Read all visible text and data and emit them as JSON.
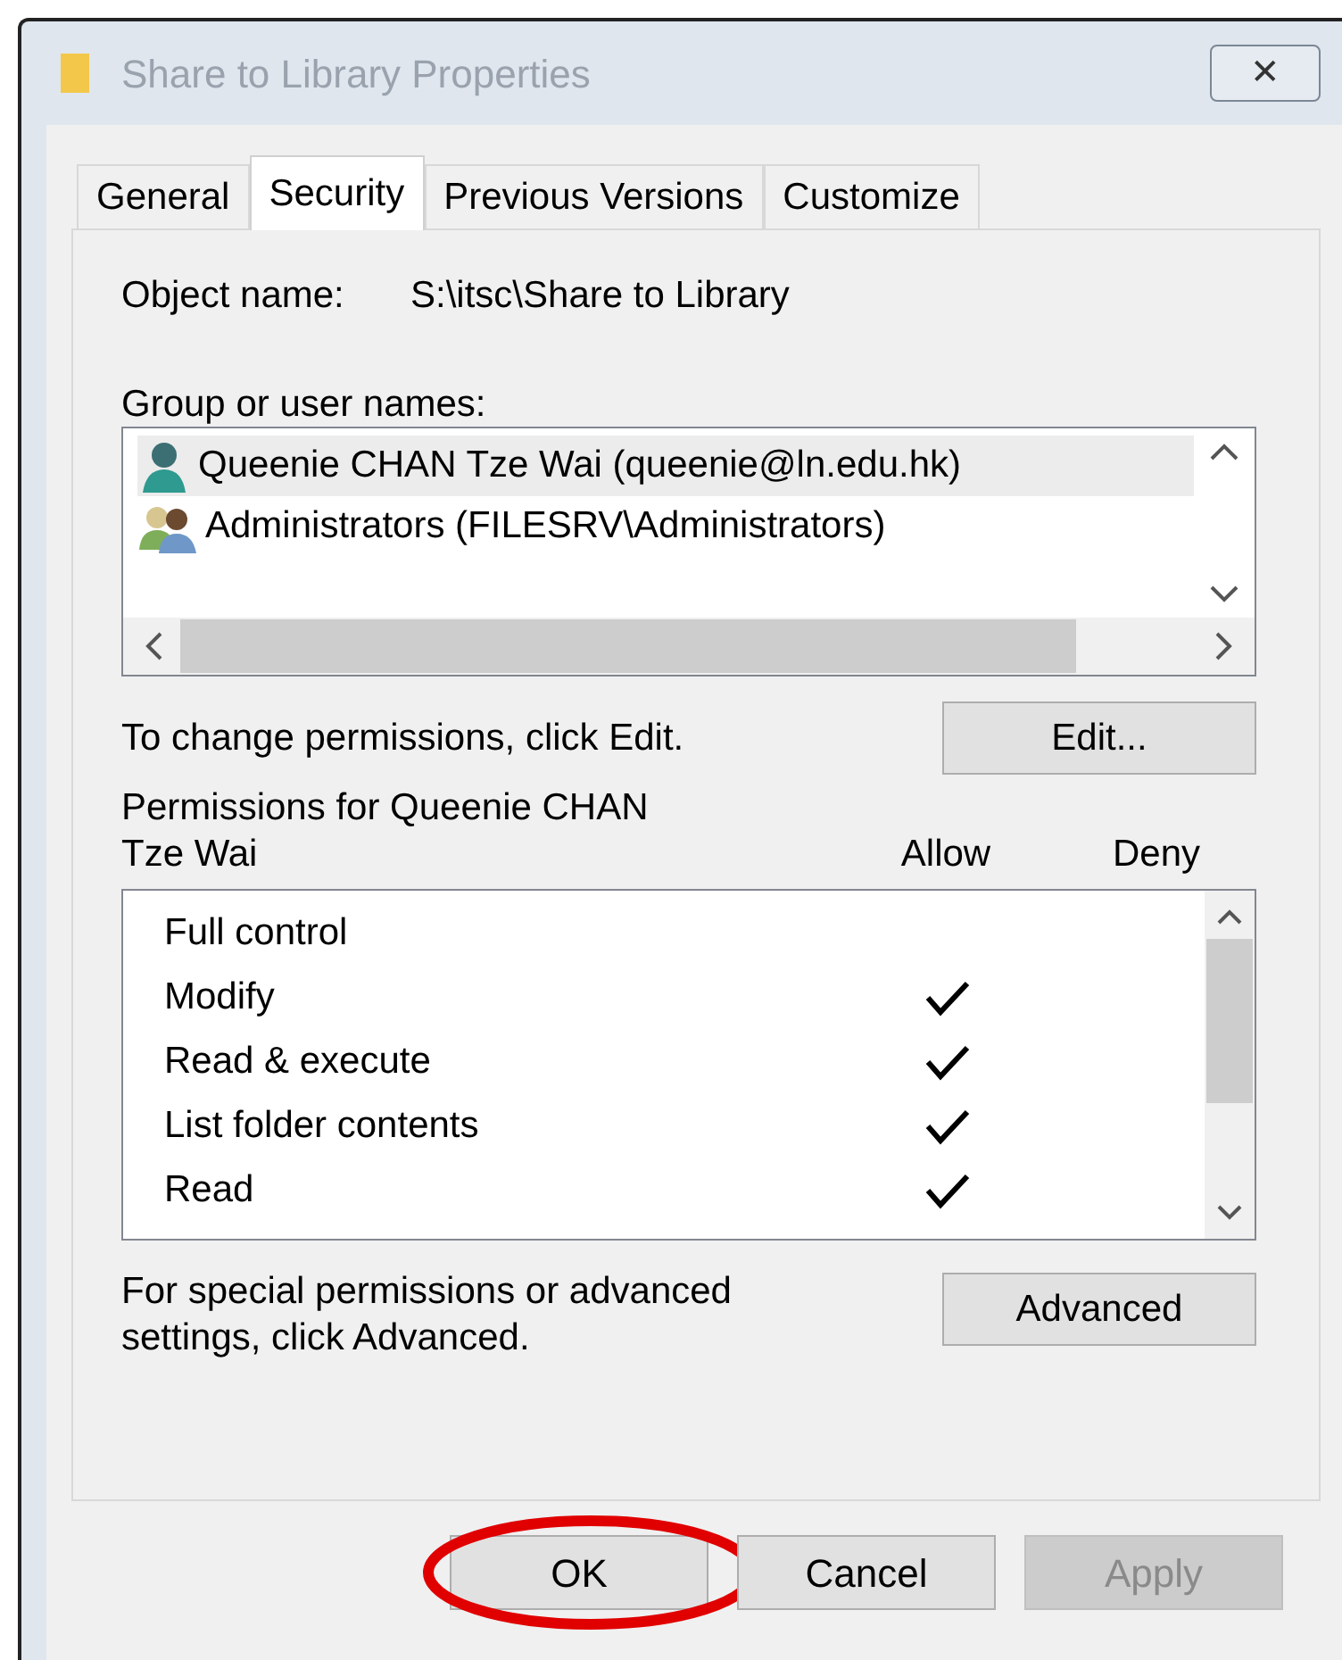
{
  "window": {
    "title": "Share to Library Properties",
    "close": "✕"
  },
  "tabs": [
    {
      "label": "General",
      "selected": false
    },
    {
      "label": "Security",
      "selected": true
    },
    {
      "label": "Previous Versions",
      "selected": false
    },
    {
      "label": "Customize",
      "selected": false
    }
  ],
  "object_name": {
    "label": "Object name:",
    "value": "S:\\itsc\\Share to Library"
  },
  "groups": {
    "label": "Group or user names:",
    "items": [
      {
        "kind": "user",
        "name": "Queenie CHAN Tze Wai (queenie@ln.edu.hk)",
        "selected": true
      },
      {
        "kind": "group",
        "name": "Administrators (FILESRV\\Administrators)",
        "selected": false
      }
    ]
  },
  "change_hint": "To change permissions, click Edit.",
  "edit_button": "Edit...",
  "permissions": {
    "title_line1": "Permissions for Queenie CHAN",
    "title_line2": "Tze Wai",
    "allow_header": "Allow",
    "deny_header": "Deny",
    "rows": [
      {
        "name": "Full control",
        "allow": false,
        "deny": false
      },
      {
        "name": "Modify",
        "allow": true,
        "deny": false
      },
      {
        "name": "Read & execute",
        "allow": true,
        "deny": false
      },
      {
        "name": "List folder contents",
        "allow": true,
        "deny": false
      },
      {
        "name": "Read",
        "allow": true,
        "deny": false
      }
    ]
  },
  "advanced_hint": "For special permissions or advanced settings, click Advanced.",
  "advanced_button": "Advanced",
  "buttons": [
    {
      "label": "OK",
      "disabled": false,
      "highlighted": true
    },
    {
      "label": "Cancel",
      "disabled": false,
      "highlighted": false
    },
    {
      "label": "Apply",
      "disabled": true,
      "highlighted": false
    }
  ]
}
